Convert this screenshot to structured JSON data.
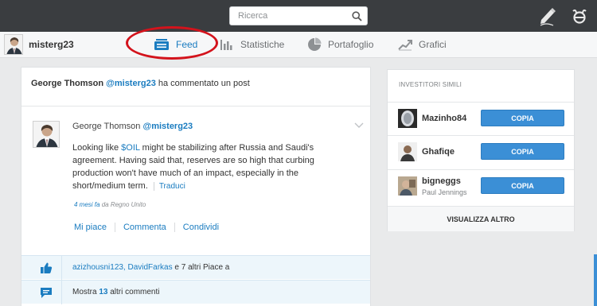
{
  "header": {
    "search_placeholder": "Ricerca",
    "icons": [
      "search-icon",
      "pencil-icon",
      "etoro-logo-icon"
    ]
  },
  "nav": {
    "username": "misterg23",
    "tabs": [
      {
        "label": "Feed",
        "icon": "feed-icon",
        "active": true
      },
      {
        "label": "Statistiche",
        "icon": "bar-chart-icon"
      },
      {
        "label": "Portafoglio",
        "icon": "pie-chart-icon"
      },
      {
        "label": "Grafici",
        "icon": "line-chart-icon"
      }
    ]
  },
  "post": {
    "activity_actor": "George Thomson",
    "activity_handle": "@misterg23",
    "activity_text": "ha commentato un post",
    "author_name": "George Thomson",
    "author_handle": "@misterg23",
    "text_before_ticker": "Looking like ",
    "ticker": "$OIL",
    "text_after_ticker": " might be stabilizing after Russia and Saudi's agreement. Having said that, reserves are so high that curbing production won't have much of an impact, especially in the short/medium term.",
    "translate": "Traduci",
    "time": "4 mesi fa",
    "location": "da Regno Unito",
    "actions": [
      "Mi piace",
      "Commenta",
      "Condividi"
    ],
    "likes": {
      "users": "azizhousni123, DavidFarkas",
      "and": "e",
      "others_count": "7",
      "suffix": "altri Piace a"
    },
    "comments": {
      "prefix": "Mostra",
      "count": "13",
      "suffix": "altri commenti"
    }
  },
  "similar": {
    "title": "INVESTITORI SIMILI",
    "investors": [
      {
        "name": "Mazinho84",
        "subtitle": "",
        "button": "COPIA"
      },
      {
        "name": "Ghafiqe",
        "subtitle": "",
        "button": "COPIA"
      },
      {
        "name": "bigneggs",
        "subtitle": "Paul Jennings",
        "button": "COPIA"
      }
    ],
    "more": "VISUALIZZA ALTRO"
  },
  "colors": {
    "accent": "#1a7cc0",
    "button": "#3b8fd6",
    "topbar": "#3a3d40",
    "highlight": "#d3131c"
  }
}
